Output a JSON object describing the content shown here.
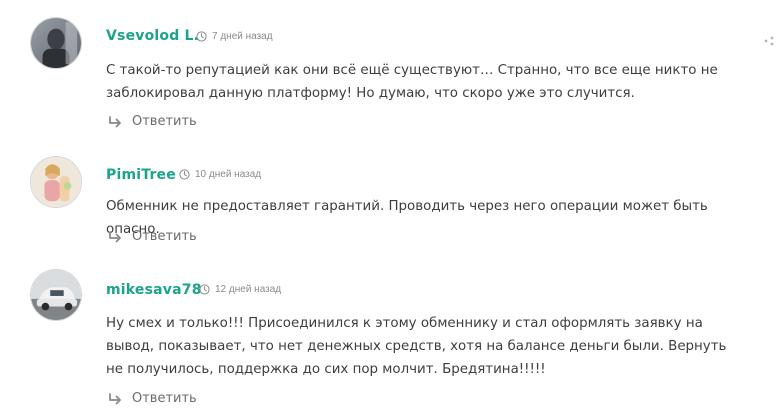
{
  "comments": [
    {
      "author": "Vsevolod L.",
      "time": "7 дней назад",
      "text": "С такой-то репутацией как они всё ещё существуют… Странно, что все еще никто не заблокировал данную платформу! Но думаю, что скоро уже это случится.",
      "reply_label": "Ответить"
    },
    {
      "author": "PimiTree",
      "time": "10 дней назад",
      "text": "Обменник не предоставляет гарантий. Проводить через него операции может быть опасно.",
      "reply_label": "Ответить"
    },
    {
      "author": "mikesava78",
      "time": "12 дней назад",
      "text": "Ну смех и только!!! Присоединился к этому обменнику и стал оформлять заявку на вывод, показывает, что нет денежных средств, хотя на балансе деньги были. Вернуть не получилось, поддержка до сих пор молчит. Бредятина!!!!!",
      "reply_label": "Ответить"
    }
  ],
  "colors": {
    "author": "#1aa58a",
    "meta": "#8a8a8a",
    "text": "#3d3d3d",
    "reply": "#6b6b6b"
  },
  "icons": [
    "clock-icon",
    "reply-arrow-icon",
    "more-options-icon"
  ]
}
